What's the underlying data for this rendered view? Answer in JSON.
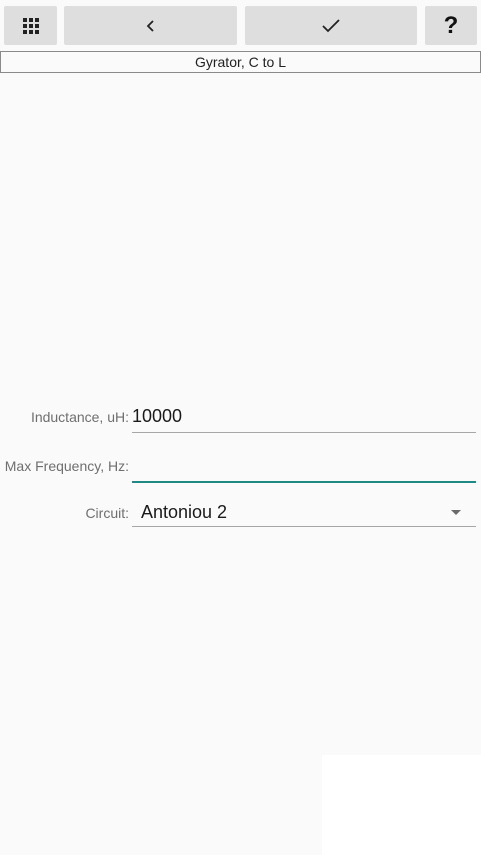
{
  "toolbar": {
    "menu_icon": "grid-icon",
    "back_icon": "chevron-left-icon",
    "ok_icon": "checkmark-icon",
    "help_label": "?"
  },
  "screen": {
    "title": "Gyrator, C to L"
  },
  "form": {
    "inductance": {
      "label": "Inductance, uH:",
      "value": "10000"
    },
    "max_frequency": {
      "label": "Max Frequency, Hz:",
      "value": ""
    },
    "circuit": {
      "label": "Circuit:",
      "selected": "Antoniou 2"
    }
  },
  "colors": {
    "focus_accent": "#1f8a84",
    "button_bg": "#dedede",
    "background": "#fafafa"
  }
}
